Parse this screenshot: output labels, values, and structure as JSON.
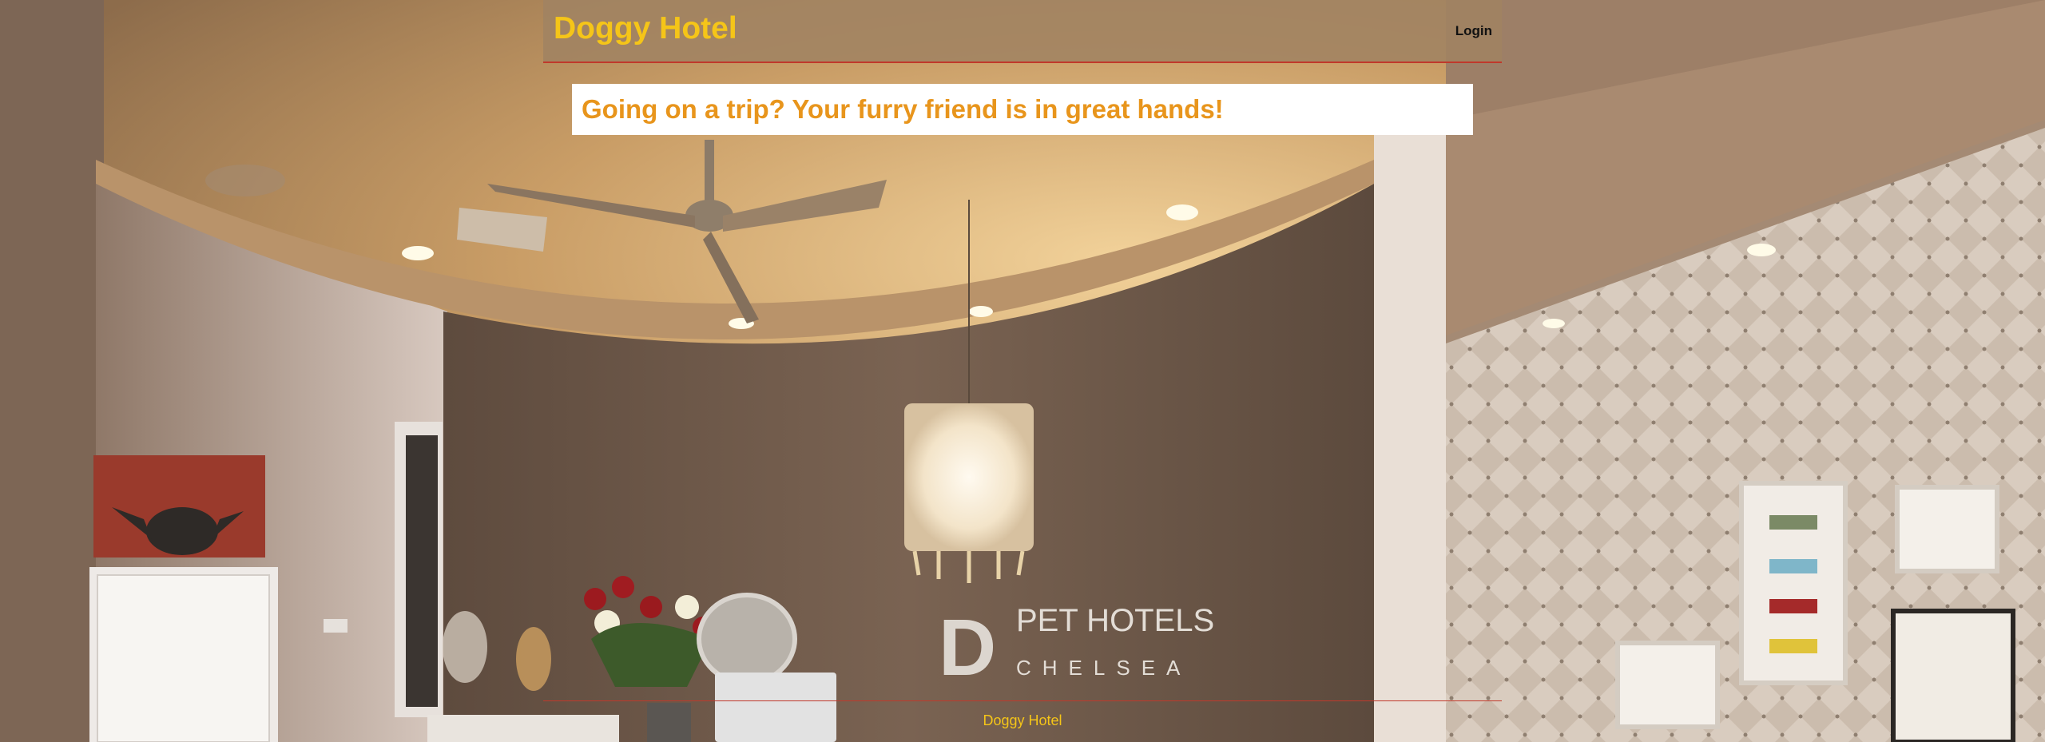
{
  "header": {
    "title": "Doggy Hotel",
    "login_label": "Login"
  },
  "banner": {
    "tagline": "Going on a trip? Your furry friend is in great hands!"
  },
  "background": {
    "sign_line1": "PET HOTELS",
    "sign_line2": "CHELSEA",
    "sign_letter": "D"
  },
  "footer": {
    "text": "Doggy Hotel"
  },
  "colors": {
    "title": "#f5c518",
    "tagline": "#e8951c",
    "accent_border": "#c0392b",
    "header_bg": "#a08362"
  }
}
